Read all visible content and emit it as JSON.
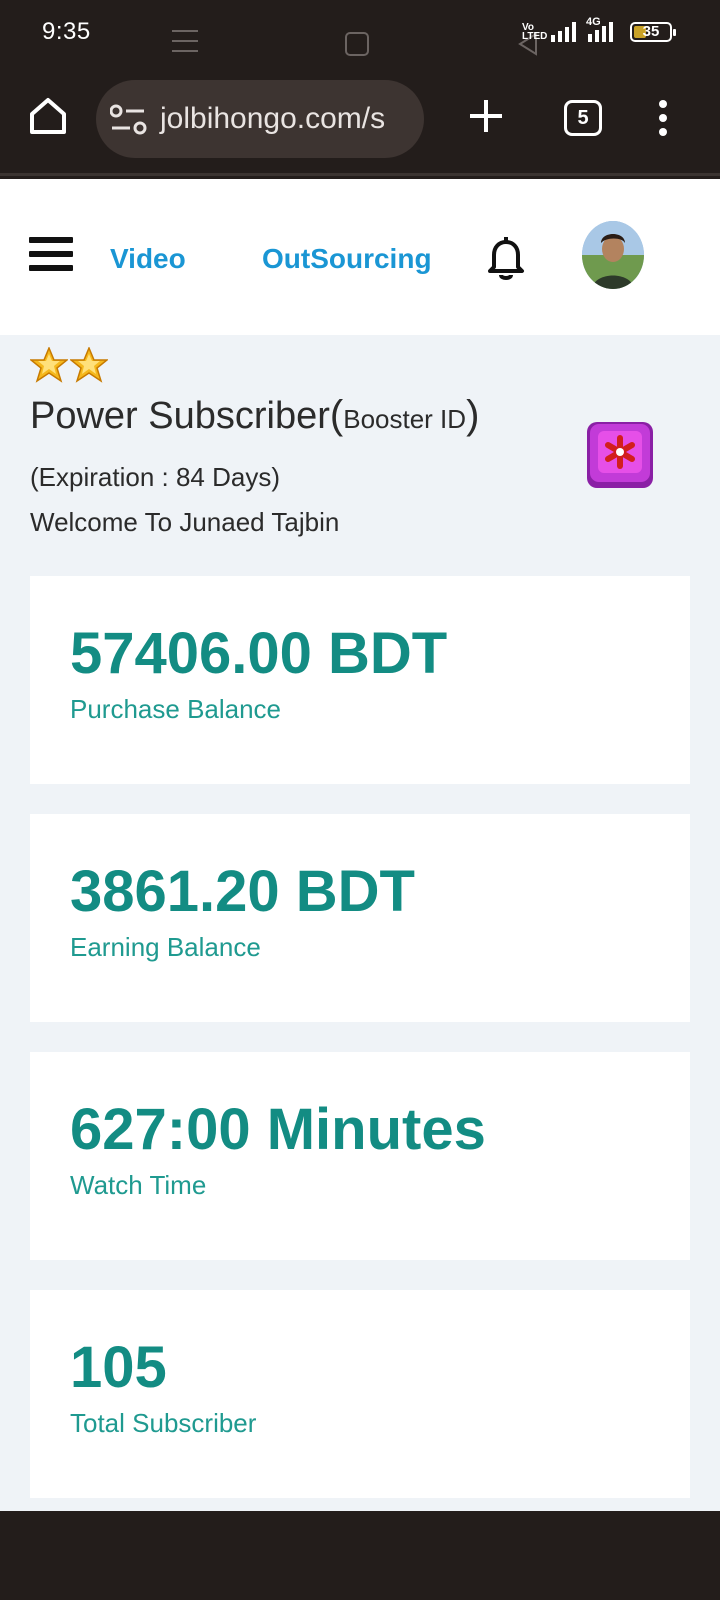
{
  "status_bar": {
    "time": "9:35",
    "volte": "Vo LTED",
    "network": "4G",
    "battery": "35",
    "battery_level": 0.35
  },
  "browser": {
    "url": "jolbihongo.com/s",
    "tab_count": "5"
  },
  "header": {
    "nav": [
      {
        "label": "Video"
      },
      {
        "label": "OutSourcing"
      }
    ]
  },
  "profile": {
    "star_count": 2,
    "title_main": "Power Subscriber",
    "title_open": "(",
    "title_small": "Booster ID",
    "title_close": ")",
    "expiration": "(Expiration : 84 Days)",
    "welcome": "Welcome To Junaed Tajbin"
  },
  "cards": [
    {
      "value": "57406.00 BDT",
      "label": "Purchase Balance"
    },
    {
      "value": "3861.20 BDT",
      "label": "Earning Balance"
    },
    {
      "value": "627:00 Minutes",
      "label": "Watch Time"
    },
    {
      "value": "105",
      "label": "Total Subscriber"
    }
  ],
  "colors": {
    "nav_link": "#1a96d4",
    "card_value": "#138c83",
    "page_bg": "#eff3f7",
    "chrome_bg": "#231d1b"
  }
}
